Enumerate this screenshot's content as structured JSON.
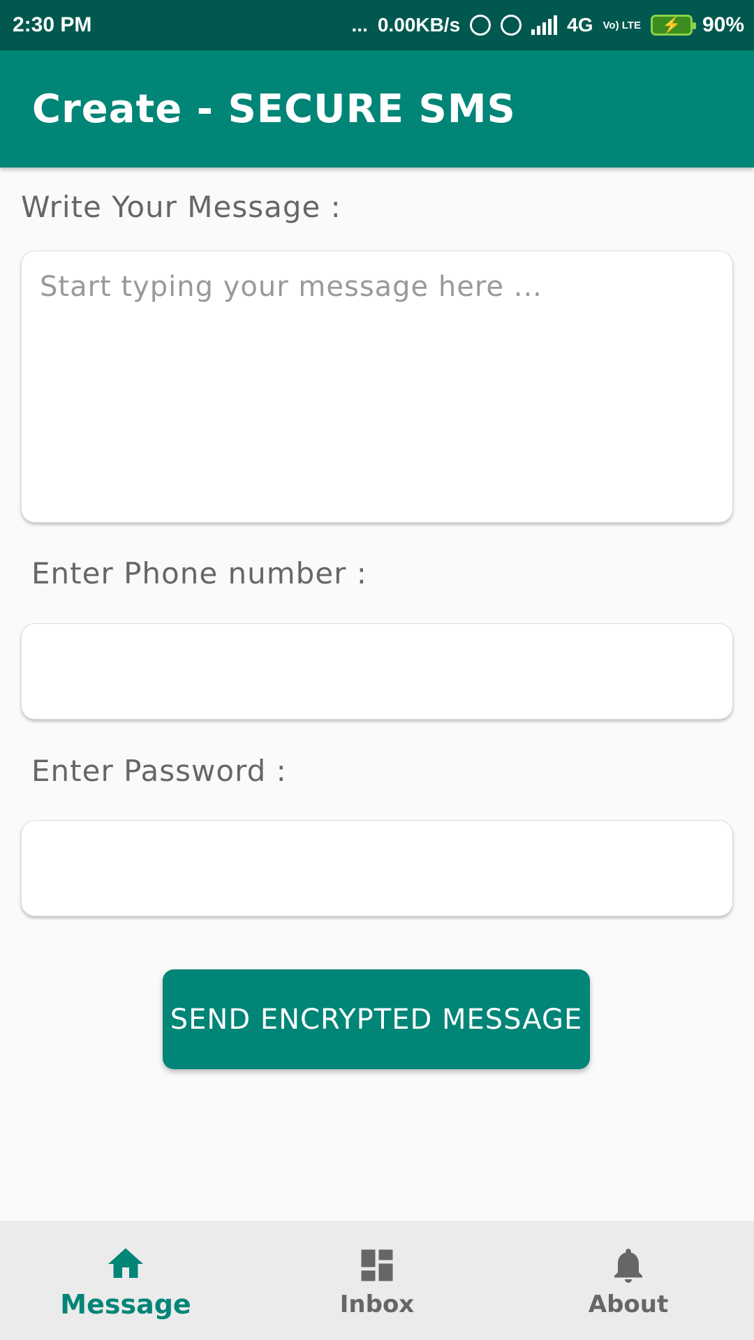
{
  "status_bar": {
    "time": "2:30 PM",
    "dots": "...",
    "network_speed": "0.00KB/s",
    "network_type": "4G",
    "volte": "Vo) LTE",
    "battery": "90%"
  },
  "app_bar": {
    "title": "Create - SECURE SMS"
  },
  "form": {
    "message_label": "Write Your Message :",
    "message_placeholder": "Start typing your message here ...",
    "message_value": "",
    "phone_label": "Enter Phone number :",
    "phone_value": "",
    "password_label": "Enter Password :",
    "password_value": ""
  },
  "send_button": {
    "label": "SEND ENCRYPTED MESSAGE"
  },
  "bottom_nav": {
    "items": [
      {
        "label": "Message",
        "icon": "home-icon",
        "active": true
      },
      {
        "label": "Inbox",
        "icon": "dashboard-icon",
        "active": false
      },
      {
        "label": "About",
        "icon": "bell-icon",
        "active": false
      }
    ]
  },
  "colors": {
    "primary": "#008577",
    "primary_dark": "#00584f",
    "background": "#fafafa",
    "label_text": "#666666"
  }
}
